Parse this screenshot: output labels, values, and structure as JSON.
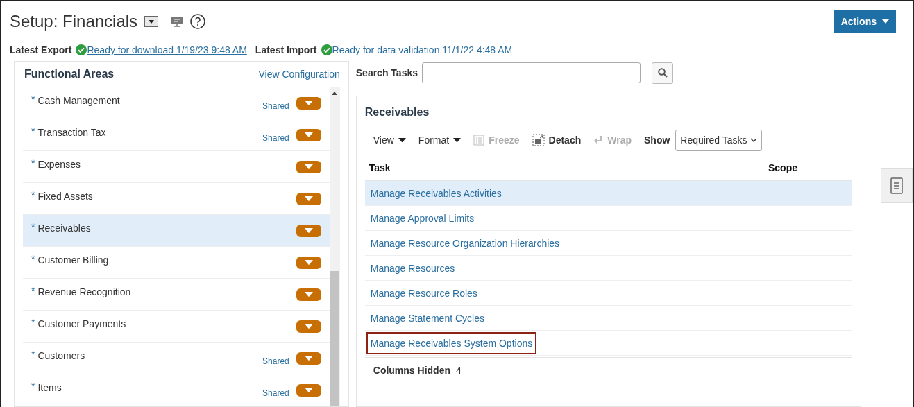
{
  "header": {
    "title": "Setup: Financials",
    "actions_button": "Actions"
  },
  "status": [
    {
      "label": "Latest Export",
      "link": "Ready for download 1/19/23 9:48 AM",
      "underlined": true
    },
    {
      "label": "Latest Import",
      "link": "Ready for data validation 11/1/22 4:48 AM",
      "underlined": false
    }
  ],
  "functional_areas": {
    "title": "Functional Areas",
    "link": "View Configuration",
    "items": [
      {
        "mark": "*",
        "name": "Cash Management",
        "tag": "Shared",
        "selected": false
      },
      {
        "mark": "*",
        "name": "Transaction Tax",
        "tag": "Shared",
        "selected": false
      },
      {
        "mark": "*",
        "name": "Expenses",
        "selected": false
      },
      {
        "mark": "*",
        "name": "Fixed Assets",
        "selected": false
      },
      {
        "mark": "*",
        "name": "Receivables",
        "selected": true
      },
      {
        "mark": "*",
        "name": "Customer Billing",
        "selected": false
      },
      {
        "mark": "*",
        "name": "Revenue Recognition",
        "selected": false
      },
      {
        "mark": "*",
        "name": "Customer Payments",
        "selected": false
      },
      {
        "mark": "*",
        "name": "Customers",
        "tag": "Shared",
        "selected": false
      },
      {
        "mark": "*",
        "name": "Items",
        "tag": "Shared",
        "selected": false
      }
    ]
  },
  "search": {
    "label": "Search Tasks"
  },
  "tasks_panel": {
    "title": "Receivables",
    "toolbar": [
      {
        "kind": "menu",
        "label": "View",
        "disabled": false
      },
      {
        "kind": "menu",
        "label": "Format",
        "disabled": false
      },
      {
        "kind": "freeze",
        "label": "Freeze",
        "disabled": true
      },
      {
        "kind": "detach",
        "label": "Detach",
        "disabled": false
      },
      {
        "kind": "wrap",
        "label": "Wrap",
        "disabled": true
      },
      {
        "kind": "select",
        "label": "Show",
        "value": "Required Tasks",
        "disabled": false
      }
    ],
    "columns": [
      "Task",
      "Scope"
    ],
    "rows": [
      {
        "task": "Manage Receivables Activities",
        "selected": true,
        "outlined": false
      },
      {
        "task": "Manage Approval Limits",
        "selected": false,
        "outlined": false
      },
      {
        "task": "Manage Resource Organization Hierarchies",
        "selected": false,
        "outlined": false
      },
      {
        "task": "Manage Resources",
        "selected": false,
        "outlined": false
      },
      {
        "task": "Manage Resource Roles",
        "selected": false,
        "outlined": false
      },
      {
        "task": "Manage Statement Cycles",
        "selected": false,
        "outlined": false
      },
      {
        "task": "Manage Receivables System Options",
        "selected": false,
        "outlined": true
      }
    ],
    "footer": {
      "label": "Columns Hidden",
      "value": "4"
    }
  }
}
